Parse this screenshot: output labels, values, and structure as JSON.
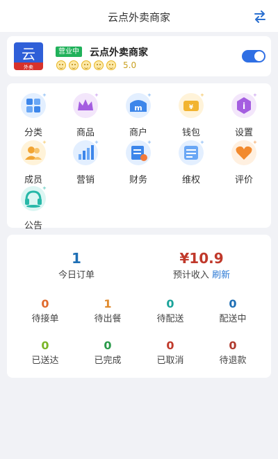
{
  "header": {
    "title": "云点外卖商家",
    "icon": "swap-icon"
  },
  "shop": {
    "logo_text": "云",
    "logo_sub": "外卖",
    "status_badge": "营业中",
    "name": "云点外卖商家",
    "rating": "5.0",
    "rating_icons": 5,
    "open": true
  },
  "menu": [
    {
      "label": "分类",
      "icon": "category-icon"
    },
    {
      "label": "商品",
      "icon": "crown-icon"
    },
    {
      "label": "商户",
      "icon": "store-icon"
    },
    {
      "label": "钱包",
      "icon": "wallet-icon"
    },
    {
      "label": "设置",
      "icon": "settings-info-icon"
    },
    {
      "label": "成员",
      "icon": "members-icon"
    },
    {
      "label": "营销",
      "icon": "marketing-chart-icon"
    },
    {
      "label": "财务",
      "icon": "finance-icon"
    },
    {
      "label": "维权",
      "icon": "rights-icon"
    },
    {
      "label": "评价",
      "icon": "heart-icon"
    },
    {
      "label": "公告",
      "icon": "headset-icon"
    }
  ],
  "summary": {
    "orders_today_value": "1",
    "orders_today_label": "今日订单",
    "income_value": "¥10.9",
    "income_label": "预计收入",
    "refresh_label": "刷新"
  },
  "order_stats": [
    {
      "value": "0",
      "label": "待接单",
      "color": "#e06a2c"
    },
    {
      "value": "1",
      "label": "待出餐",
      "color": "#e0892c"
    },
    {
      "value": "0",
      "label": "待配送",
      "color": "#1aa39a"
    },
    {
      "value": "0",
      "label": "配送中",
      "color": "#1e6fb5"
    },
    {
      "value": "0",
      "label": "已送达",
      "color": "#7ab527"
    },
    {
      "value": "0",
      "label": "已完成",
      "color": "#2a9a4a"
    },
    {
      "value": "0",
      "label": "已取消",
      "color": "#c0392b"
    },
    {
      "value": "0",
      "label": "待退款",
      "color": "#b03a2e"
    }
  ],
  "colors": {
    "accent": "#2f6fe4",
    "badge": "#20b15a",
    "income": "#c0392b",
    "orders": "#1e6fb5"
  }
}
